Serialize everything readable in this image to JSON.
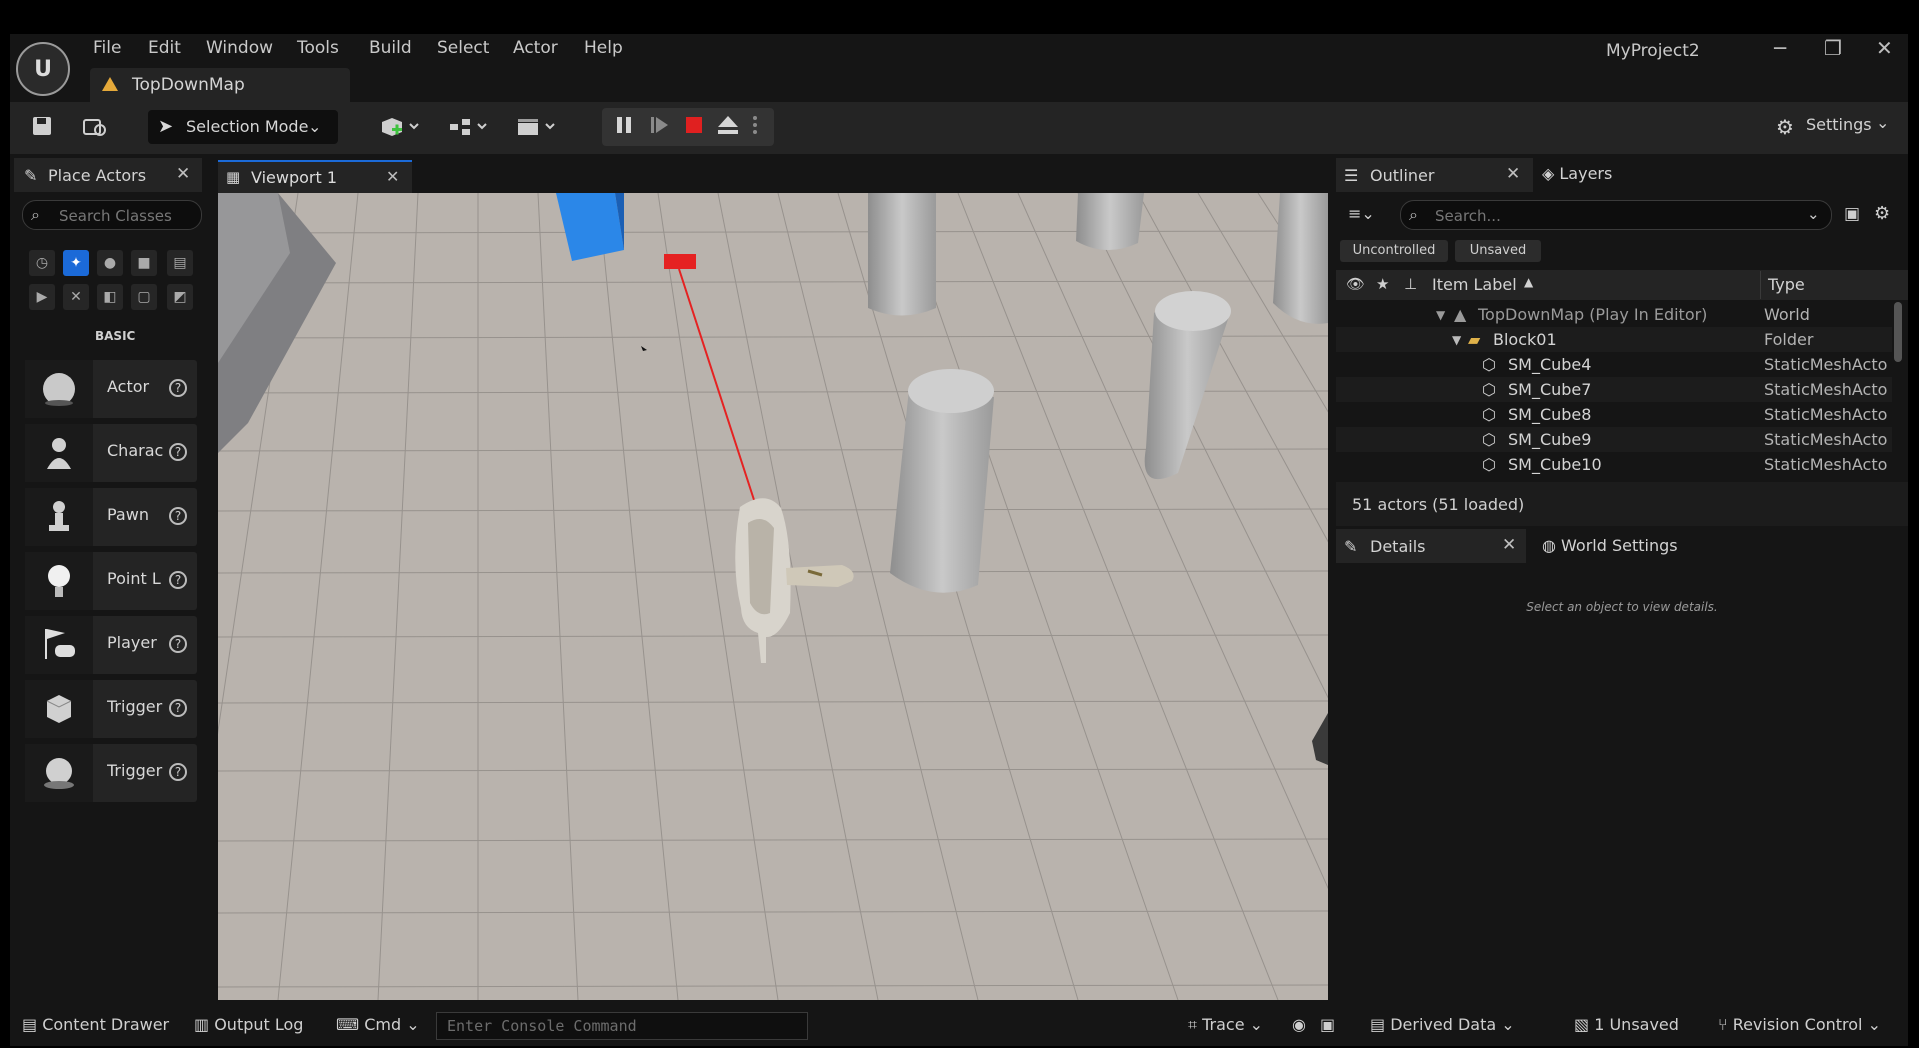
{
  "app": {
    "project_name": "MyProject2",
    "logo_text": "U"
  },
  "menu": [
    "File",
    "Edit",
    "Window",
    "Tools",
    "Build",
    "Select",
    "Actor",
    "Help"
  ],
  "map_tab": {
    "label": "TopDownMap"
  },
  "window_controls": {
    "minimize": "─",
    "restore": "❐",
    "close": "✕"
  },
  "toolbar": {
    "selection_mode": "Selection Mode",
    "settings": "Settings"
  },
  "place_actors": {
    "tab_label": "Place Actors",
    "search_placeholder": "Search Classes",
    "category_label": "BASIC",
    "items": [
      {
        "label": "Actor",
        "icon": "sphere-icon"
      },
      {
        "label": "Charac",
        "icon": "character-icon"
      },
      {
        "label": "Pawn",
        "icon": "pawn-icon"
      },
      {
        "label": "Point L",
        "icon": "light-bulb-icon"
      },
      {
        "label": "Player",
        "icon": "player-start-icon"
      },
      {
        "label": "Trigger",
        "icon": "trigger-box-icon"
      },
      {
        "label": "Trigger",
        "icon": "trigger-sphere-icon"
      }
    ]
  },
  "viewport": {
    "tab_label": "Viewport 1"
  },
  "outliner": {
    "tab_label": "Outliner",
    "layers_label": "Layers",
    "search_placeholder": "Search...",
    "filters": [
      "Uncontrolled",
      "Unsaved"
    ],
    "columns": {
      "label": "Item Label",
      "type": "Type"
    },
    "rows": [
      {
        "label": "TopDownMap (Play In Editor)",
        "type": "World"
      },
      {
        "label": "Block01",
        "type": "Folder"
      },
      {
        "label": "SM_Cube4",
        "type": "StaticMeshActo"
      },
      {
        "label": "SM_Cube7",
        "type": "StaticMeshActo"
      },
      {
        "label": "SM_Cube8",
        "type": "StaticMeshActo"
      },
      {
        "label": "SM_Cube9",
        "type": "StaticMeshActo"
      },
      {
        "label": "SM_Cube10",
        "type": "StaticMeshActo"
      }
    ],
    "status": "51 actors (51 loaded)"
  },
  "details": {
    "tab_label": "Details",
    "world_settings_label": "World Settings",
    "empty_message": "Select an object to view details."
  },
  "bottom": {
    "content_drawer": "Content Drawer",
    "output_log": "Output Log",
    "cmd": "Cmd",
    "console_placeholder": "Enter Console Command",
    "trace": "Trace",
    "derived_data": "Derived Data",
    "unsaved": "1 Unsaved",
    "revision_control": "Revision Control"
  },
  "colors": {
    "accent": "#1b6ad8",
    "stop": "#e02020",
    "map_icon": "#e5a93a",
    "selected_cube": "#2b87e8"
  }
}
